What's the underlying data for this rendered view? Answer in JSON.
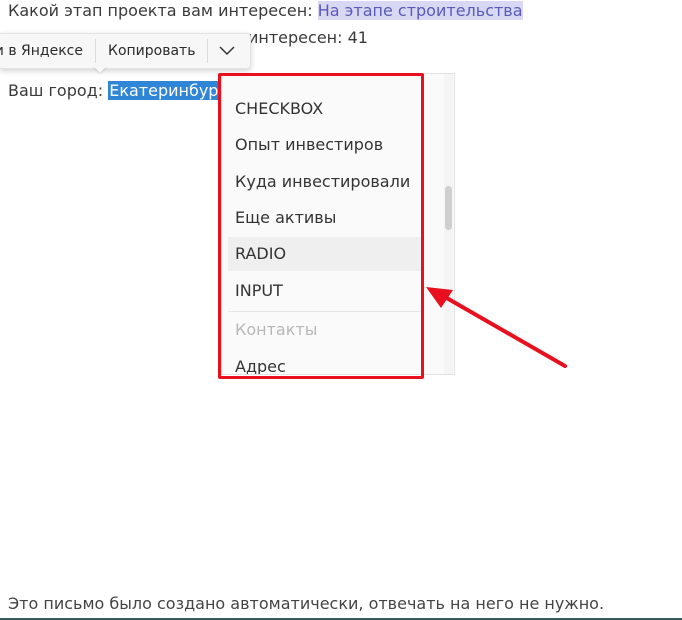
{
  "email": {
    "line1_label": "Какой этап проекта вам интересен:",
    "line1_value": "На этапе строительства",
    "line2_partial": "интересен: 41",
    "line3_partial": "",
    "city_label": "Ваш город:",
    "city_value": "Екатеринбург"
  },
  "context_toolbar": {
    "search_label": "Найти в Яндексе",
    "copy_label": "Копировать",
    "more_icon": "chevron-down-icon"
  },
  "dropdown": {
    "items": [
      {
        "label": "CHECKBOX",
        "state": "normal"
      },
      {
        "label": "Опыт инвестиров",
        "state": "normal"
      },
      {
        "label": "Куда инвестировали",
        "state": "normal"
      },
      {
        "label": "Еще активы",
        "state": "normal"
      },
      {
        "label": "RADIO",
        "state": "hover"
      },
      {
        "label": "INPUT",
        "state": "normal"
      },
      {
        "label": "Контакты",
        "state": "disabled"
      },
      {
        "label": "Адрес",
        "state": "normal"
      }
    ]
  },
  "annotation": {
    "box_color": "#e8101e",
    "arrow_color": "#e8101e"
  },
  "footer": {
    "text": "Это письмо было создано автоматически, отвечать на него не нужно."
  },
  "colors": {
    "selection_lavender": "#d8d8f4",
    "selection_blue": "#2f86d6"
  }
}
